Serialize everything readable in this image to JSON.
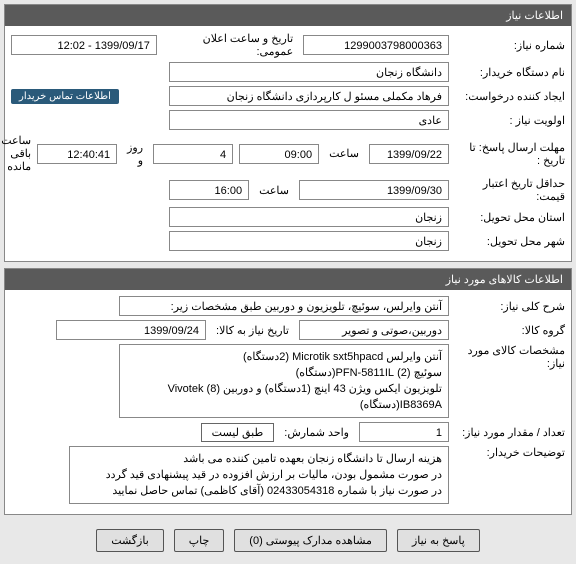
{
  "section_need": {
    "title": "اطلاعات نیاز",
    "need_no_label": "شماره نیاز:",
    "need_no": "1299003798000363",
    "public_announce_label": "تاریخ و ساعت اعلان عمومی:",
    "public_announce": "1399/09/17 - 12:02",
    "buyer_org_label": "نام دستگاه خریدار:",
    "buyer_org": "دانشگاه زنجان",
    "requester_label": "ایجاد کننده درخواست:",
    "requester": "فرهاد مکملی مسئو ل کارپردازی دانشگاه زنجان",
    "contact_link": "اطلاعات تماس خریدار",
    "priority_label": "اولویت نیاز :",
    "priority": "عادی",
    "reply_deadline_label": "مهلت ارسال پاسخ:",
    "to_date_label": "تا تاریخ :",
    "reply_date": "1399/09/22",
    "time_label_1": "ساعت",
    "reply_time": "09:00",
    "days": "4",
    "day_and_label": "روز و",
    "countdown": "12:40:41",
    "remaining_label": "ساعت باقی مانده",
    "min_valid_label": "حداقل تاریخ اعتبار قیمت:",
    "min_valid_date": "1399/09/30",
    "time_label_2": "ساعت",
    "min_valid_time": "16:00",
    "province_label": "استان محل تحویل:",
    "province": "زنجان",
    "city_label": "شهر محل تحویل:",
    "city": "زنجان"
  },
  "section_items": {
    "title": "اطلاعات کالاهای مورد نیاز",
    "desc_label": "شرح کلی نیاز:",
    "desc": "آنتن وایرلس، سوئیچ، تلویزیون و دوربین طبق مشخصات زیر:",
    "group_label": "گروه کالا:",
    "group": "دوربین،صوتی و تصویر",
    "need_date_label": "تاریخ نیاز به کالا:",
    "need_date": "1399/09/24",
    "spec_label": "مشخصات کالای مورد نیاز:",
    "spec": "آنتن وایرلس Microtik sxt5hpacd (2دستگاه)\nسوئیچ (2) PFN-5811IL(دستگاه)\nتلویزیون ایکس ویژن 43 اینچ (1دستگاه) و دوربین (8) Vivotek IB8369A(دستگاه)",
    "qty_label": "تعداد / مقدار مورد نیاز:",
    "qty": "1",
    "unit_label": "واحد شمارش:",
    "unit": "طبق لیست",
    "notes_label": "توضیحات خریدار:",
    "notes": "هزینه ارسال تا دانشگاه زنجان بعهده تامین کننده می باشد\nدر صورت مشمول بودن، مالیات بر ارزش افزوده در قید پیشنهادی قید گردد\nدر صورت نیاز با شماره 02433054318 (آقای کاظمی) تماس حاصل نمایید"
  },
  "buttons": {
    "reply": "پاسخ به نیاز",
    "attachments": "مشاهده مدارک پیوستی (0)",
    "print": "چاپ",
    "back": "بازگشت"
  }
}
